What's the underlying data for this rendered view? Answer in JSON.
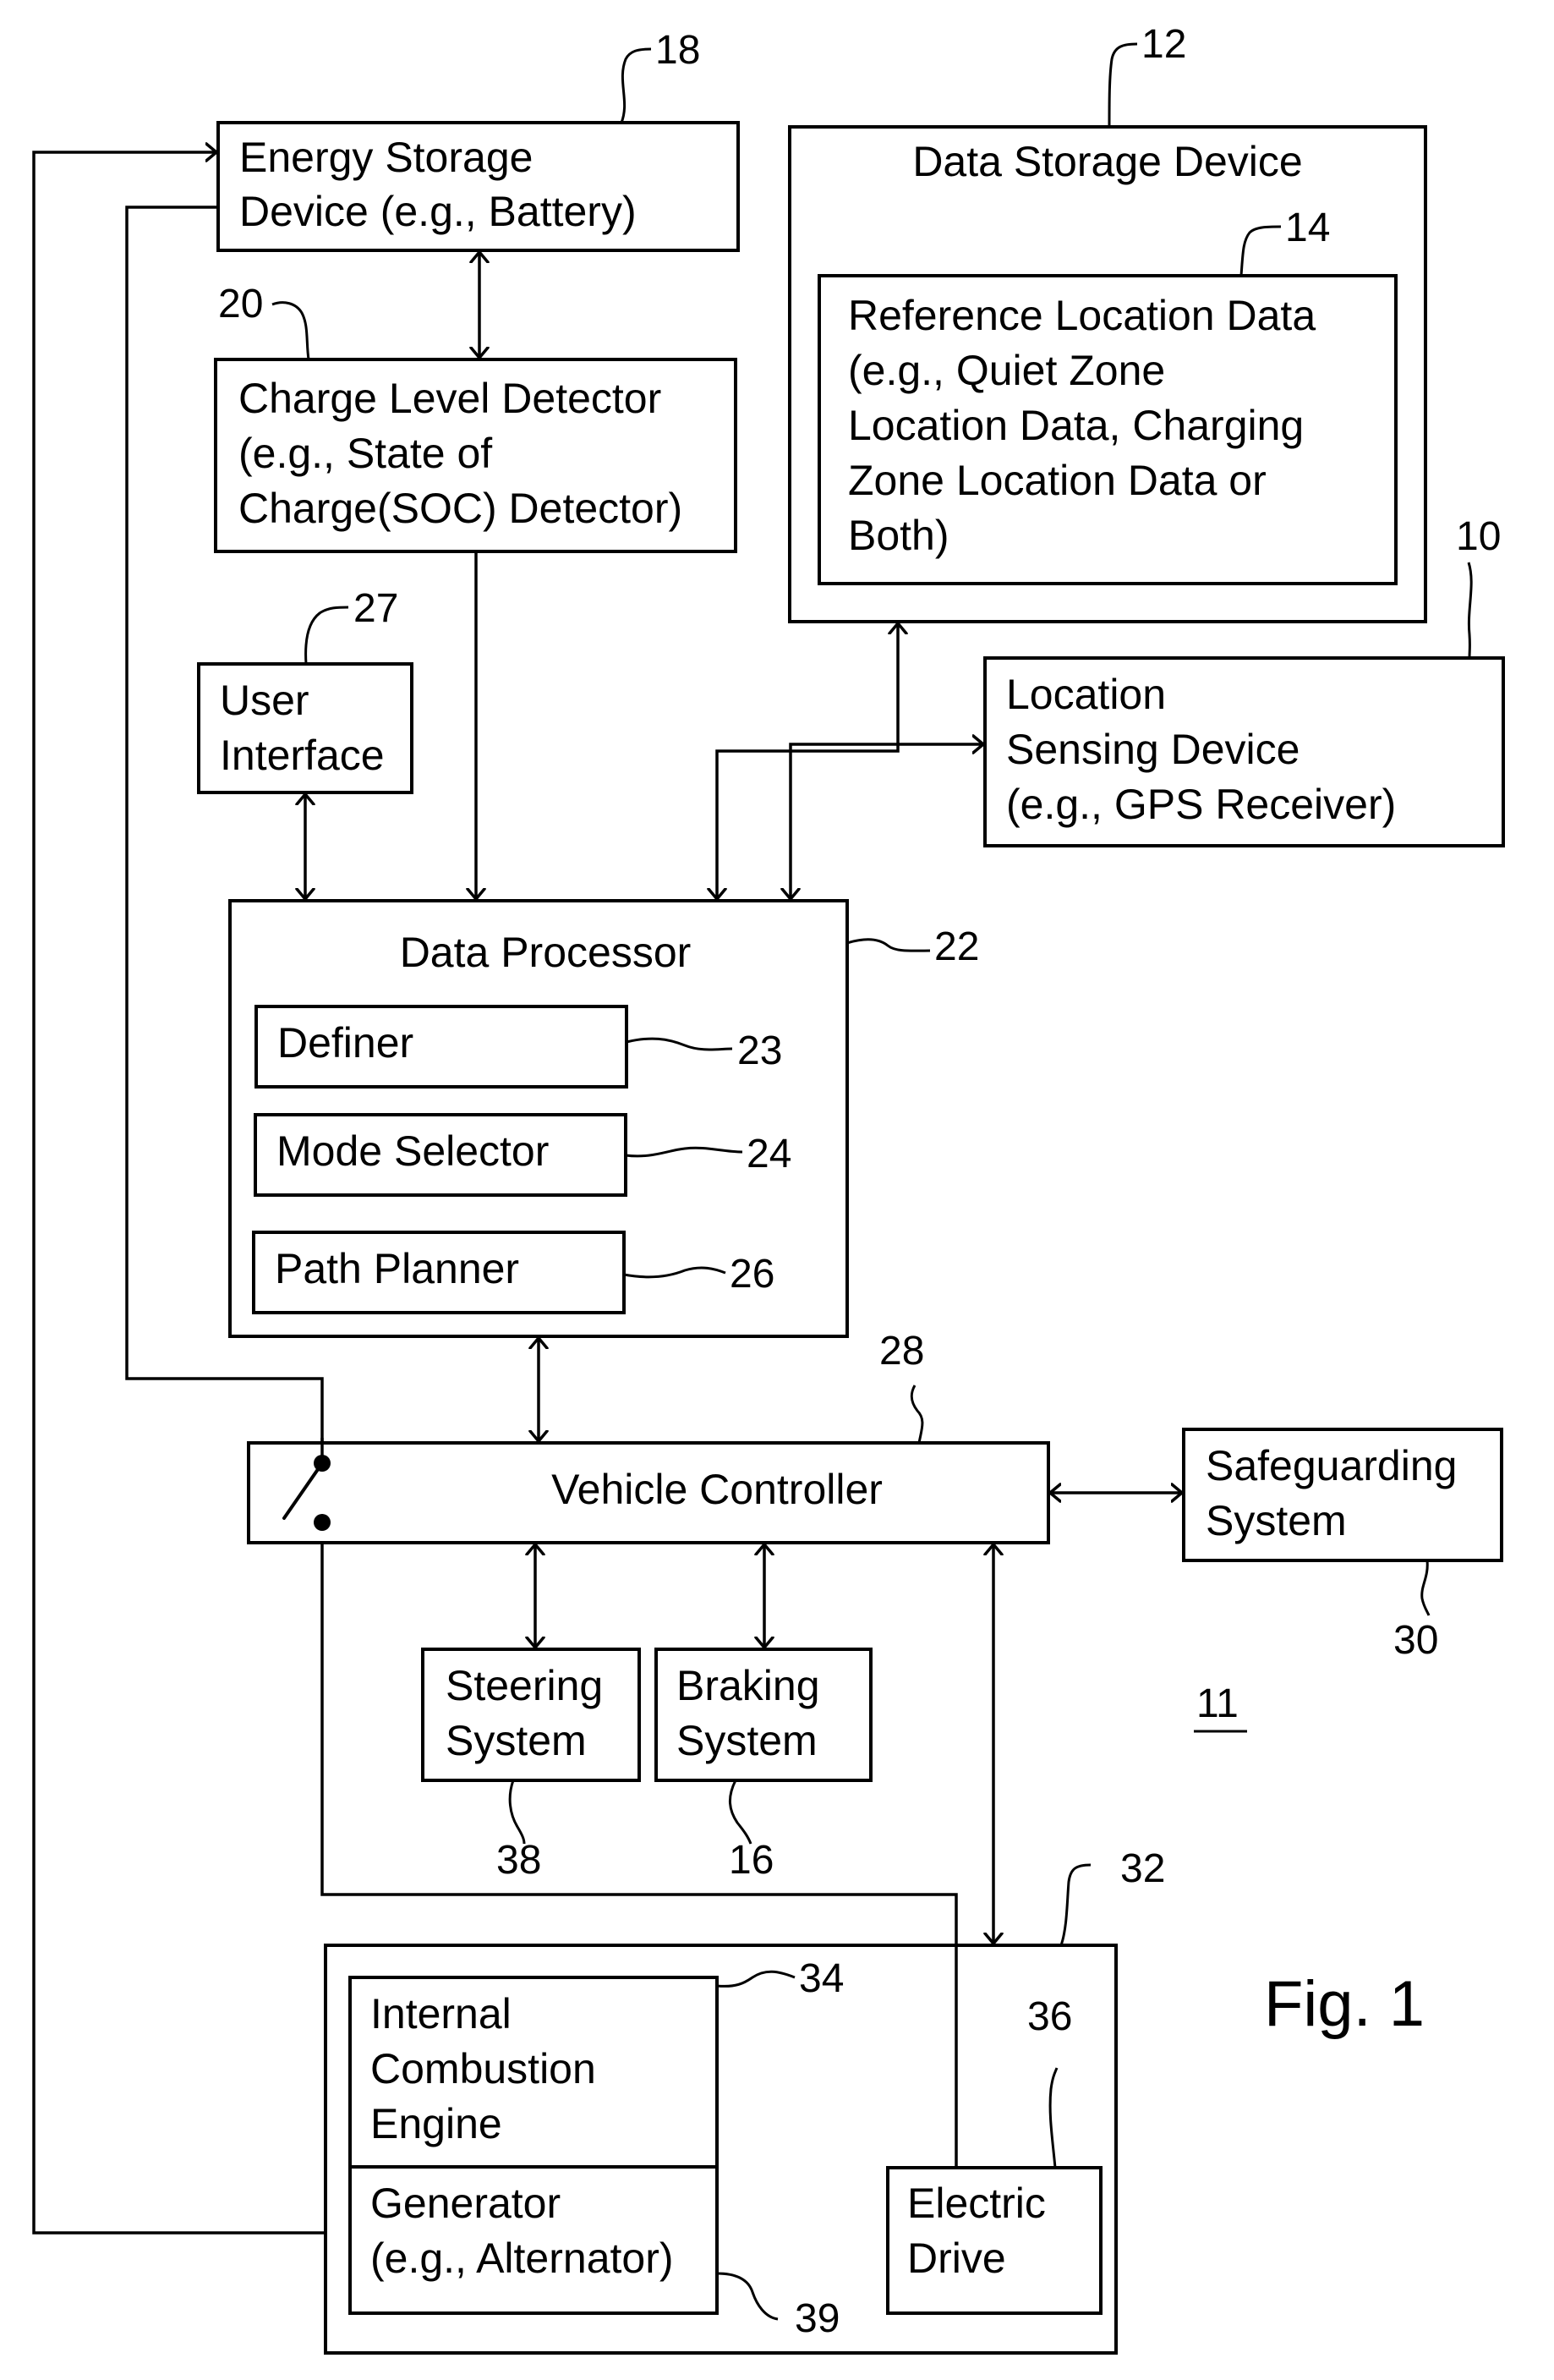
{
  "figure": {
    "title": "Fig. 1",
    "system_ref": "11"
  },
  "blocks": {
    "energy_storage": {
      "ref": "18",
      "lines": [
        "Energy Storage",
        "Device (e.g., Battery)"
      ]
    },
    "data_storage": {
      "ref": "12",
      "lines": [
        "Data Storage Device"
      ]
    },
    "reference_location_data": {
      "ref": "14",
      "lines": [
        "Reference Location Data",
        "(e.g., Quiet Zone",
        "Location Data, Charging",
        "Zone Location Data or",
        "Both)"
      ]
    },
    "charge_level_detector": {
      "ref": "20",
      "lines": [
        "Charge Level Detector",
        "(e.g., State of",
        "Charge(SOC) Detector)"
      ]
    },
    "user_interface": {
      "ref": "27",
      "lines": [
        "User",
        "Interface"
      ]
    },
    "location_sensing": {
      "ref": "10",
      "lines": [
        "Location",
        "Sensing Device",
        "(e.g., GPS Receiver)"
      ]
    },
    "data_processor": {
      "ref": "22",
      "lines": [
        "Data Processor"
      ]
    },
    "definer": {
      "ref": "23",
      "lines": [
        "Definer"
      ]
    },
    "mode_selector": {
      "ref": "24",
      "lines": [
        "Mode Selector"
      ]
    },
    "path_planner": {
      "ref": "26",
      "lines": [
        "Path Planner"
      ]
    },
    "vehicle_controller": {
      "ref": "28",
      "lines": [
        "Vehicle Controller"
      ]
    },
    "safeguarding": {
      "ref": "30",
      "lines": [
        "Safeguarding",
        "System"
      ]
    },
    "steering": {
      "ref": "38",
      "lines": [
        "Steering",
        "System"
      ]
    },
    "braking": {
      "ref": "16",
      "lines": [
        "Braking",
        "System"
      ]
    },
    "propulsion_unit": {
      "ref": "32",
      "lines": []
    },
    "combustion_engine": {
      "ref": "34",
      "lines": [
        "Internal",
        "Combustion",
        "Engine"
      ]
    },
    "generator": {
      "ref": "39",
      "lines": [
        "Generator",
        "(e.g., Alternator)"
      ]
    },
    "electric_drive": {
      "ref": "36",
      "lines": [
        "Electric",
        "Drive"
      ]
    }
  },
  "connections": [
    {
      "from": "energy_storage",
      "to": "charge_level_detector",
      "type": "bidirectional"
    },
    {
      "from": "charge_level_detector",
      "to": "data_processor",
      "type": "unidirectional"
    },
    {
      "from": "user_interface",
      "to": "data_processor",
      "type": "bidirectional"
    },
    {
      "from": "data_processor",
      "to": "data_storage",
      "type": "bidirectional"
    },
    {
      "from": "data_processor",
      "to": "location_sensing",
      "type": "bidirectional"
    },
    {
      "from": "data_processor",
      "to": "vehicle_controller",
      "type": "bidirectional"
    },
    {
      "from": "vehicle_controller",
      "to": "safeguarding",
      "type": "bidirectional"
    },
    {
      "from": "vehicle_controller",
      "to": "steering",
      "type": "bidirectional"
    },
    {
      "from": "vehicle_controller",
      "to": "braking",
      "type": "bidirectional"
    },
    {
      "from": "vehicle_controller",
      "to": "propulsion_unit",
      "type": "bidirectional"
    },
    {
      "from": "energy_storage",
      "to": "electric_drive",
      "type": "switched",
      "via": "vehicle_controller_switch"
    },
    {
      "from": "generator",
      "to": "energy_storage",
      "type": "unidirectional"
    },
    {
      "from": "generator",
      "to": "electric_drive",
      "type": "dashed-bidirectional"
    }
  ]
}
